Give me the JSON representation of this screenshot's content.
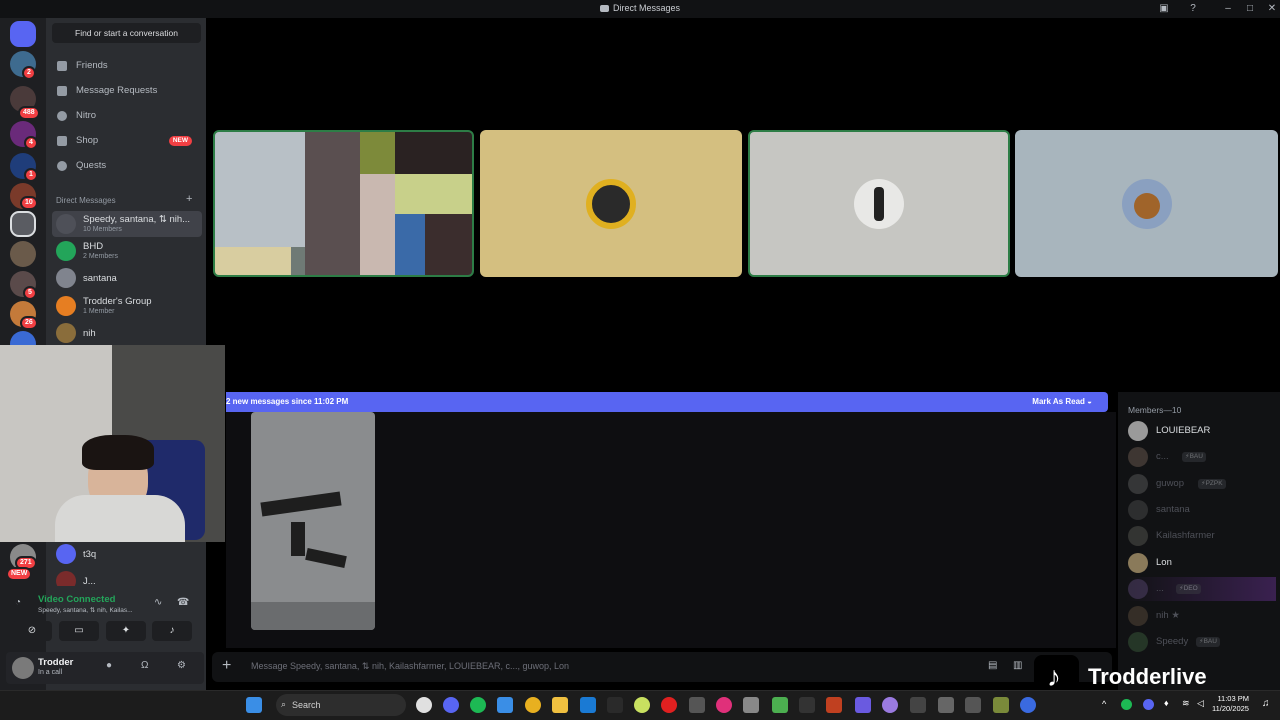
{
  "window": {
    "title": "Direct Messages"
  },
  "rail": {
    "badges": [
      "2",
      "488",
      "4",
      "1",
      "10",
      "5",
      "26",
      "271"
    ],
    "new_badge": "NEW"
  },
  "sidebar": {
    "find_placeholder": "Find or start a conversation",
    "nav": [
      {
        "label": "Friends",
        "icon": "friends-icon"
      },
      {
        "label": "Message Requests",
        "icon": "envelope-icon"
      },
      {
        "label": "Nitro",
        "icon": "nitro-icon"
      },
      {
        "label": "Shop",
        "icon": "shop-icon",
        "tag": "NEW"
      },
      {
        "label": "Quests",
        "icon": "quests-icon"
      }
    ],
    "dm_header": "Direct Messages",
    "dm_add": "+",
    "dms": [
      {
        "name": "Speedy, santana, ⇅ nih...",
        "sub": "10 Members",
        "color": "#4e5058"
      },
      {
        "name": "BHD",
        "sub": "2 Members",
        "color": "#23a55a"
      },
      {
        "name": "santana",
        "sub": "",
        "color": "#80848e"
      },
      {
        "name": "Trodder's Group",
        "sub": "1 Member",
        "color": "#e67e22"
      },
      {
        "name": "nih",
        "sub": "",
        "color": "#8a6d3b"
      },
      {
        "name": "t3q",
        "sub": "",
        "color": "#5865f2"
      },
      {
        "name": "J...",
        "sub": "",
        "color": "#7a2b2b"
      }
    ]
  },
  "call": {
    "status": "Video Connected",
    "channel": "Speedy, santana, ⇅ nih, Kailas...",
    "buttons": [
      "camera-off-icon",
      "screen-share-icon",
      "activities-icon",
      "soundboard-icon"
    ]
  },
  "user": {
    "name": "Trodder",
    "status": "In a call"
  },
  "stage": {
    "tiles": [
      {
        "bg": "#6f7a75",
        "speaking": true
      },
      {
        "bg": "#d4bf80",
        "speaking": false
      },
      {
        "bg": "#c6c6c2",
        "speaking": true
      },
      {
        "bg": "#a8b5bd",
        "speaking": false
      }
    ]
  },
  "chat": {
    "new_messages": "2 new messages since 11:02 PM",
    "mark_read": "Mark As Read",
    "composer_placeholder": "Message Speedy, santana, ⇅ nih, Kailashfarmer, LOUIEBEAR, c..., guwop, Lon"
  },
  "members": {
    "header": "Members—10",
    "list": [
      {
        "name": "LOUIEBEAR",
        "tag": "",
        "color": "#dbdee1",
        "av": "#9a9a9a"
      },
      {
        "name": "c...",
        "tag": "⚡BAU",
        "color": "#4e5058",
        "av": "#6b5a50"
      },
      {
        "name": "guwop",
        "tag": "⚡PZPK",
        "color": "#4e5058",
        "av": "#5a5a5a"
      },
      {
        "name": "santana",
        "tag": "",
        "color": "#4e5058",
        "av": "#4a4a4a"
      },
      {
        "name": "Kailashfarmer",
        "tag": "",
        "color": "#4e5058",
        "av": "#55554f"
      },
      {
        "name": "Lon",
        "tag": "",
        "color": "#dbdee1",
        "av": "#8a7a5a"
      },
      {
        "name": "...",
        "tag": "⚡DEO",
        "color": "#4e5058",
        "av": "#4b3c60"
      },
      {
        "name": "nih ★",
        "tag": "",
        "color": "#4e5058",
        "av": "#5a4a3a"
      },
      {
        "name": "Speedy",
        "tag": "⚡BAU",
        "color": "#4e5058",
        "av": "#3a5a3a"
      }
    ]
  },
  "overlay": {
    "brand": "Trodderlive"
  },
  "taskbar": {
    "search": "Search",
    "time": "11:03 PM",
    "date": "11/20/2025"
  },
  "colors": {
    "accent": "#5865f2",
    "online": "#23a55a",
    "danger": "#f23f43"
  }
}
